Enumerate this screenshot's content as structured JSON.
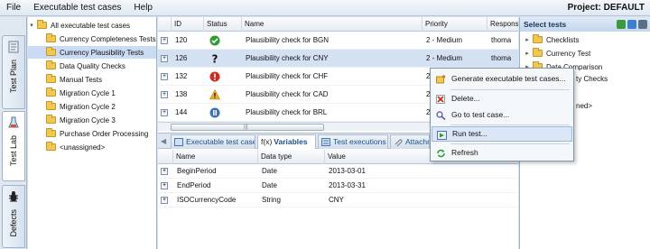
{
  "menubar": {
    "items": [
      "File",
      "Executable test cases",
      "Help"
    ],
    "project": "Project: DEFAULT"
  },
  "sidebar_tabs": [
    "Test Plan",
    "Test Lab",
    "Defects"
  ],
  "tree": {
    "root": "All executable test cases",
    "items": [
      "Currency Completeness Tests",
      "Currency Plausibility Tests",
      "Data Quality Checks",
      "Manual Tests",
      "Migration Cycle 1",
      "Migration Cycle 2",
      "Migration Cycle 3",
      "Purchase Order Processing",
      "<unassigned>"
    ],
    "selected_index": 1
  },
  "table": {
    "columns": [
      "ID",
      "Status",
      "Name",
      "Priority",
      "Responsi"
    ],
    "rows": [
      {
        "id": "120",
        "status": "passed",
        "name": "Plausibility check for BGN",
        "priority": "2 - Medium",
        "resp": "thoma"
      },
      {
        "id": "126",
        "status": "unknown",
        "name": "Plausibility check for CNY",
        "priority": "2 - Medium",
        "resp": "thoma"
      },
      {
        "id": "132",
        "status": "failed",
        "name": "Plausibility check for CHF",
        "priority": "2",
        "resp": ""
      },
      {
        "id": "138",
        "status": "warning",
        "name": "Plausibility check for CAD",
        "priority": "2",
        "resp": ""
      },
      {
        "id": "144",
        "status": "info",
        "name": "Plausibility check for BRL",
        "priority": "2",
        "resp": ""
      }
    ],
    "selected_index": 1
  },
  "bottom_tabs": [
    "Executable test case",
    "Variables",
    "Test executions",
    "Attachm"
  ],
  "bottom_tabs_prefix": "f(x)",
  "variables": {
    "columns": [
      "Name",
      "Data type",
      "Value"
    ],
    "rows": [
      {
        "name": "BeginPeriod",
        "type": "Date",
        "value": "2013-03-01"
      },
      {
        "name": "EndPeriod",
        "type": "Date",
        "value": "2013-03-31"
      },
      {
        "name": "ISOCurrencyCode",
        "type": "String",
        "value": "CNY"
      }
    ]
  },
  "right_panel": {
    "title": "Select tests",
    "items": [
      "Checklists",
      "Currency Test",
      "Data Comparison"
    ],
    "partial_texts": [
      "ty Checks",
      "ned>"
    ]
  },
  "context_menu": {
    "items": [
      "Generate executable test cases...",
      "Delete...",
      "Go to test case...",
      "Run test...",
      "Refresh"
    ],
    "hover_index": 3
  },
  "colors": {
    "passed": "#2e9b2e",
    "failed": "#d42a1e",
    "warning": "#f0b323",
    "info": "#3f6fb5",
    "selection": "#d3e1f3"
  }
}
